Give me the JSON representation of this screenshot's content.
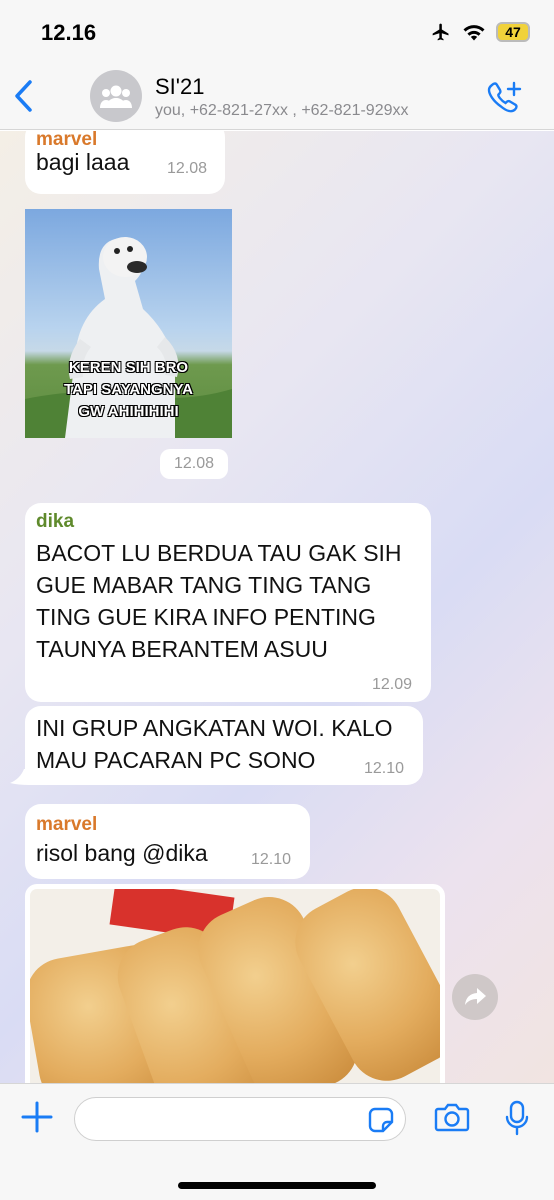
{
  "status": {
    "time": "12.16",
    "battery": "47"
  },
  "header": {
    "title": "SI'21",
    "subtitle": "you, +62-821-27xx , +62-821-929xx"
  },
  "messages": [
    {
      "sender": "marvel",
      "text": "bagi laaa",
      "time": "12.08"
    },
    {
      "sticker_caption": [
        "KEREN SIH BRO",
        "TAPI SAYANGNYA",
        "GW AHIHIHIHI"
      ],
      "time": "12.08"
    },
    {
      "sender": "dika",
      "lines": [
        "BACOT LU BERDUA TAU GAK SIH",
        "GUE MABAR TANG TING TANG",
        "TING GUE KIRA INFO PENTING",
        "TAUNYA BERANTEM ASUU"
      ],
      "time": "12.09"
    },
    {
      "lines": [
        "INI GRUP ANGKATAN WOI. KALO",
        "MAU PACARAN PC SONO"
      ],
      "time": "12.10"
    },
    {
      "sender": "marvel",
      "text": "risol bang @dika",
      "time": "12.10"
    }
  ],
  "input": {
    "placeholder": ""
  },
  "colors": {
    "accent": "#1a7cf5",
    "marvel": "#d9792b",
    "dika": "#5f8a2c"
  },
  "icons": [
    "back-chevron-icon",
    "group-avatar-icon",
    "add-call-icon",
    "forward-icon",
    "plus-icon",
    "sticker-icon",
    "camera-icon",
    "microphone-icon",
    "airplane-icon",
    "wifi-icon"
  ]
}
